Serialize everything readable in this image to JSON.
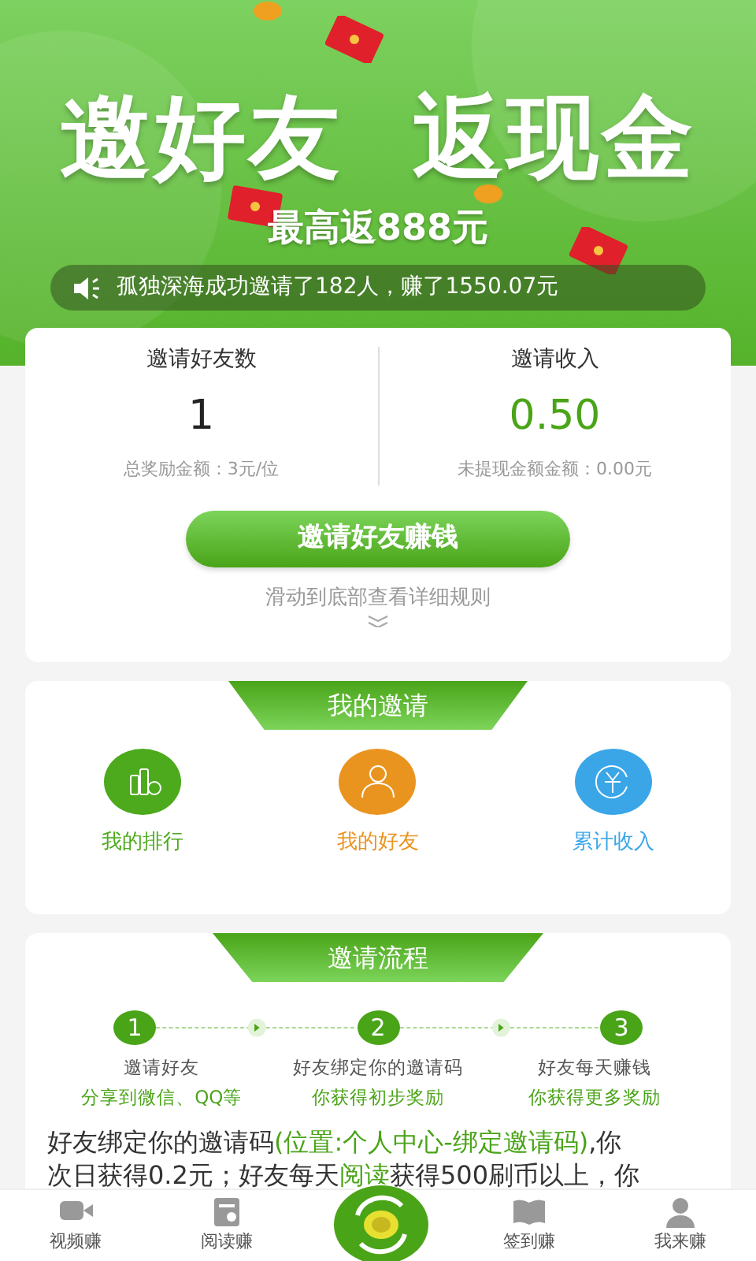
{
  "banner": {
    "headline": [
      "邀好友",
      "返现金"
    ],
    "subtitle": "最高返888元",
    "ticker": "孤独深海成功邀请了182人，赚了1550.07元"
  },
  "stats": [
    {
      "label": "邀请好友数",
      "value": "1",
      "note": "总奖励金额：3元/位",
      "kind": "plain"
    },
    {
      "label": "邀请收入",
      "value": "0.50",
      "note": "未提现金额金额：0.00元",
      "kind": "money"
    }
  ],
  "invite_button": "邀请好友赚钱",
  "scroll_hint": "滑动到底部查看详细规则",
  "my_invites": {
    "title": "我的邀请",
    "items": [
      {
        "label": "我的排行",
        "kind": "ranking",
        "color": "#4caa1c"
      },
      {
        "label": "我的好友",
        "kind": "friends",
        "color": "#ea9420"
      },
      {
        "label": "累计收入",
        "kind": "income",
        "color": "#3aa6e8"
      }
    ]
  },
  "process": {
    "title": "邀请流程",
    "steps": [
      {
        "number": "1",
        "title": "邀请好友",
        "detail": "分享到微信、QQ等"
      },
      {
        "number": "2",
        "title": "好友绑定你的邀请码",
        "detail": "你获得初步奖励"
      },
      {
        "number": "3",
        "title": "好友每天赚钱",
        "detail": "你获得更多奖励"
      }
    ],
    "rules": [
      [
        {
          "text": "好友绑定你的邀请码",
          "kind": "plain"
        },
        {
          "text": "(位置:个人中心-绑定邀请码)",
          "kind": "highlight"
        },
        {
          "text": ",你",
          "kind": "plain"
        }
      ],
      [
        {
          "text": "次日获得0.2元；好友每天",
          "kind": "plain"
        },
        {
          "text": "阅读",
          "kind": "highlight"
        },
        {
          "text": "获得500刷币以上，你",
          "kind": "plain"
        }
      ]
    ]
  },
  "tab_bar": [
    {
      "label": "视频赚",
      "kind": "video"
    },
    {
      "label": "阅读赚",
      "kind": "read"
    },
    {
      "kind": "center"
    },
    {
      "label": "签到赚",
      "kind": "checkin"
    },
    {
      "label": "我来赚",
      "kind": "me"
    }
  ]
}
